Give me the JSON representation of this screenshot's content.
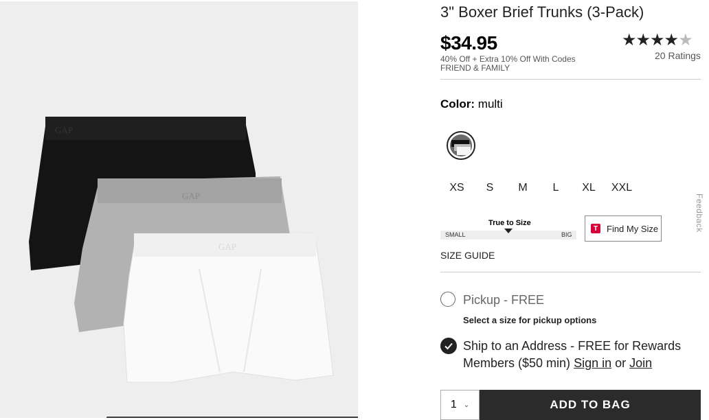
{
  "product": {
    "title": "3\" Boxer Brief Trunks (3-Pack)",
    "price": "$34.95",
    "promo_line1": "40% Off + Extra 10% Off With Codes",
    "promo_line2": "FRIEND & FAMILY",
    "rating_value": 4.5,
    "rating_stars": "★★★★",
    "rating_half": "★",
    "ratings_count": "20 Ratings",
    "image_text": "GAP"
  },
  "color": {
    "label": "Color:",
    "value": "multi"
  },
  "sizes": [
    "XS",
    "S",
    "M",
    "L",
    "XL",
    "XXL"
  ],
  "fit": {
    "title": "True to Size",
    "small": "SMALL",
    "big": "BIG",
    "find_my_size": "Find My Size",
    "find_logo": "T",
    "size_guide": "SIZE GUIDE"
  },
  "fulfillment": {
    "pickup_label": "Pickup - FREE",
    "pickup_note": "Select a size for pickup options",
    "ship_text": "Ship to an Address - FREE for Rewards Members ($50 min)",
    "sign_in": "Sign in",
    "or": "or",
    "join": "Join"
  },
  "cart": {
    "quantity": "1",
    "add_label": "ADD TO BAG"
  },
  "feedback_label": "Feedback",
  "colors": {
    "black_trunk": "#141414",
    "gray_trunk": "#b2b2b2",
    "white_trunk": "#fafafa",
    "button_bg": "#2b2b2b",
    "true_fit_red": "#d5003a"
  },
  "icons": {
    "swatch": "multi-color-swatch",
    "check": "check-icon",
    "chevron": "chevron-down-icon"
  }
}
